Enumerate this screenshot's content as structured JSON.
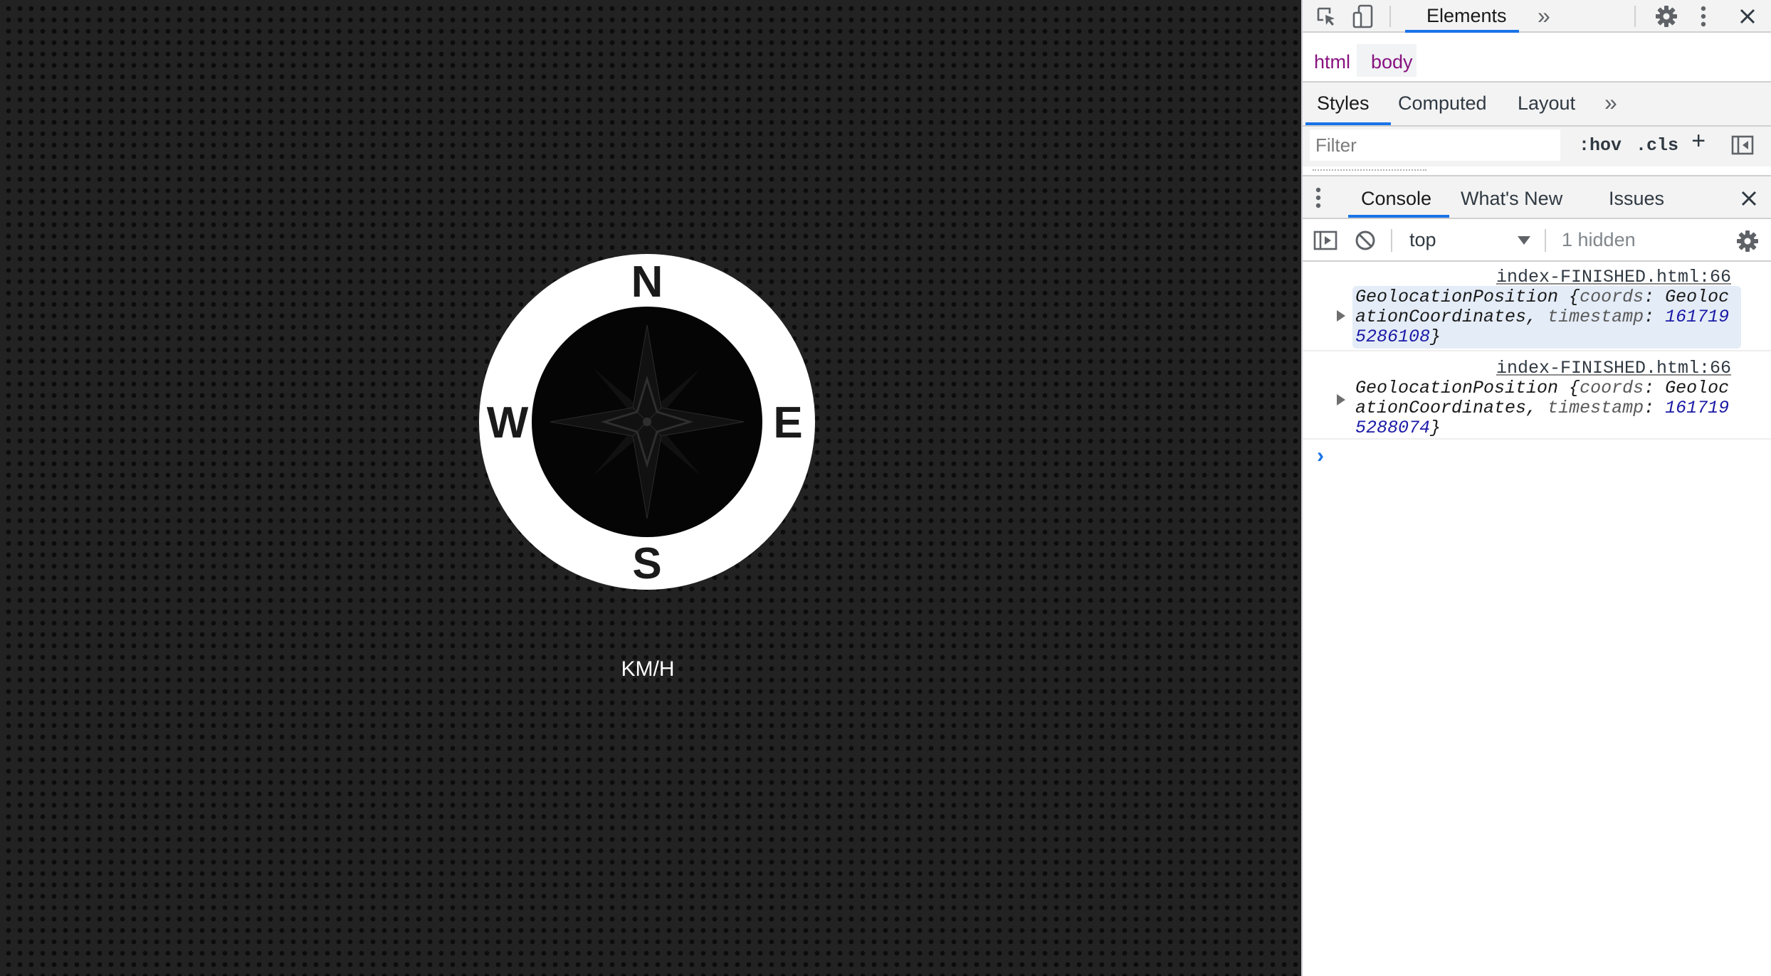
{
  "page": {
    "compass": {
      "north": "N",
      "south": "S",
      "east": "E",
      "west": "W"
    },
    "speed_unit": "KM/H"
  },
  "devtools": {
    "main_tabs": {
      "elements": "Elements",
      "more": "»"
    },
    "breadcrumbs": [
      "html",
      "body"
    ],
    "styles_tabs": {
      "styles": "Styles",
      "computed": "Computed",
      "layout": "Layout",
      "more": "»"
    },
    "filter": {
      "placeholder": "Filter",
      "hov": ":hov",
      "cls": ".cls",
      "add": "+"
    },
    "drawer_tabs": {
      "console": "Console",
      "whats_new": "What's New",
      "issues": "Issues"
    },
    "console_toolbar": {
      "context": "top",
      "hidden_count": "1 hidden"
    },
    "logs": [
      {
        "source": "index-FINISHED.html:66",
        "object_name": "GeolocationPosition",
        "coords_key": "coords",
        "coords_value": "GeolocationCoordinates",
        "timestamp_key": "timestamp",
        "timestamp_value": "1617195286108"
      },
      {
        "source": "index-FINISHED.html:66",
        "object_name": "GeolocationPosition",
        "coords_key": "coords",
        "coords_value": "GeolocationCoordinates",
        "timestamp_key": "timestamp",
        "timestamp_value": "1617195288074"
      }
    ],
    "prompt": "›",
    "colors": {
      "accent": "#1a73e8",
      "tag": "#881280",
      "number": "#1a1aa6",
      "log_highlight": "#e4ecf7"
    }
  }
}
